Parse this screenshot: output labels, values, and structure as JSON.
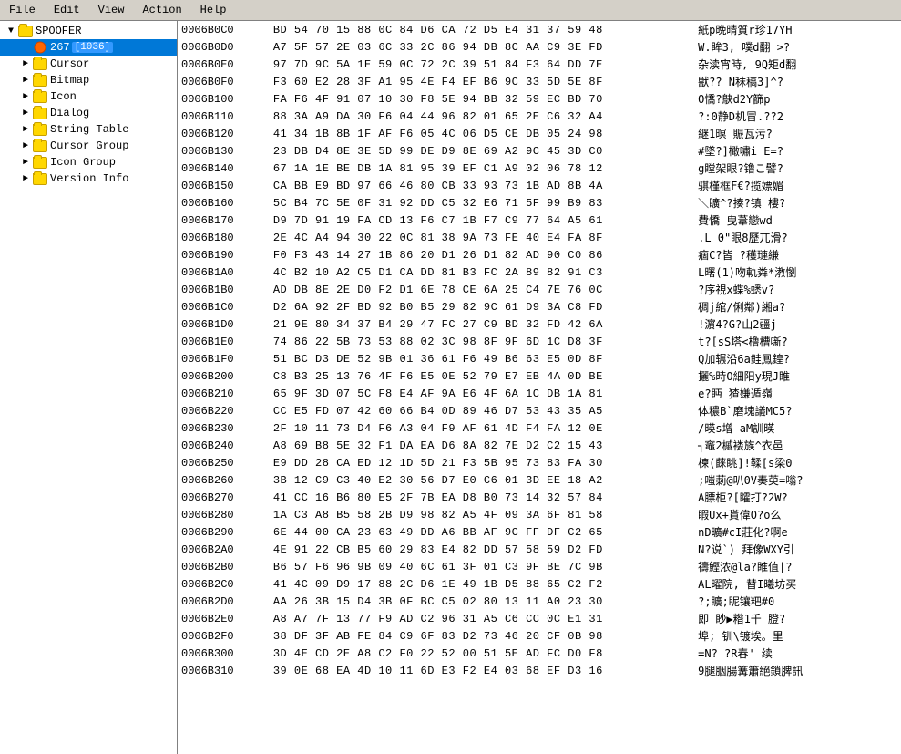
{
  "menu": {
    "items": [
      "File",
      "Edit",
      "View",
      "Action",
      "Help"
    ]
  },
  "sidebar": {
    "root": {
      "label": "SPOOFER",
      "expanded": true
    },
    "selected_item": {
      "label": "267",
      "badge": "[1036]"
    },
    "items": [
      {
        "id": "cursor",
        "label": "Cursor",
        "level": 2,
        "folder": true
      },
      {
        "id": "bitmap",
        "label": "Bitmap",
        "level": 2,
        "folder": true
      },
      {
        "id": "icon",
        "label": "Icon",
        "level": 2,
        "folder": true
      },
      {
        "id": "dialog",
        "label": "Dialog",
        "level": 2,
        "folder": true
      },
      {
        "id": "string-table",
        "label": "String Table",
        "level": 2,
        "folder": true
      },
      {
        "id": "cursor-group",
        "label": "Cursor Group",
        "level": 2,
        "folder": true
      },
      {
        "id": "icon-group",
        "label": "Icon Group",
        "level": 2,
        "folder": true
      },
      {
        "id": "version-info",
        "label": "Version Info",
        "level": 2,
        "folder": true
      }
    ]
  },
  "hex_rows": [
    {
      "addr": "0006B0C0",
      "bytes": "BD 54 70 15 88 0C 84 D6 CA 72 D5 E4 31 37 59 48",
      "ascii": "紙p晩晴質r珍17YH"
    },
    {
      "addr": "0006B0D0",
      "bytes": "A7 5F 57 2E 03 6C 33 2C 86 94 DB 8C AA C9 3E FD",
      "ascii": "W.眸3, 噗d翻 >?"
    },
    {
      "addr": "0006B0E0",
      "bytes": "97 7D 9C 5A 1E 59 0C 72 2C 39 51 84 F3 64 DD 7E",
      "ascii": "杂渎宵時, 9Q矩d翻"
    },
    {
      "addr": "0006B0F0",
      "bytes": "F3 60 E2 28 3F A1 95 4E F4 EF B6 9C 33 5D 5E 8F",
      "ascii": "獣?? N秣稿3]^?"
    },
    {
      "addr": "0006B100",
      "bytes": "FA F6 4F 91 07 10 30 F8 5E 94 BB 32 59 EC BD 70",
      "ascii": "O憍?鴃d2Y篩p"
    },
    {
      "addr": "0006B110",
      "bytes": "88 3A A9 DA 30 F6 04 44 96 82 01 65 2E C6 32 A4",
      "ascii": "?:0静D机冒.??2"
    },
    {
      "addr": "0006B120",
      "bytes": "41 34 1B 8B 1F AF F6 05 4C 06 D5 CE DB 05 24 98",
      "ascii": "継1暝  賑瓦污?"
    },
    {
      "addr": "0006B130",
      "bytes": "23 DB D4 8E 3E 5D 99 DE D9 8E 69 A2 9C 45 3D C0",
      "ascii": "#墜?]橄嘯i  E=?"
    },
    {
      "addr": "0006B140",
      "bytes": "67 1A 1E BE DB 1A 81 95 39 EF C1 A9 02 06 78 12",
      "ascii": "g瞠架眼?镥こ譬?"
    },
    {
      "addr": "0006B150",
      "bytes": "CA BB E9 BD 97 66 46 80 CB 33 93 73 1B AD 8B 4A",
      "ascii": "骐槿框F€?揽嫖媚"
    },
    {
      "addr": "0006B160",
      "bytes": "5C B4 7C 5E 0F 31 92 DD C5 32 E6 71 5F 99 B9 83",
      "ascii": "＼矌^?揍?镇 樓?"
    },
    {
      "addr": "0006B170",
      "bytes": "D9 7D 91 19 FA CD 13 F6 C7 1B F7 C9 77 64 A5 61",
      "ascii": "費憍 曳葦戀wd"
    },
    {
      "addr": "0006B180",
      "bytes": "2E 4C A4 94 30 22 0C 81 38 9A 73 FE 40 E4 FA 8F",
      "ascii": ".L 0\"眼8歷兀滑?"
    },
    {
      "addr": "0006B190",
      "bytes": "F0 F3 43 14 27 1B 86 20 D1 26 D1 82 AD 90 C0 86",
      "ascii": "痼C?皆 ?穫璉縑"
    },
    {
      "addr": "0006B1A0",
      "bytes": "4C B2 10 A2 C5 D1 CA DD 81 B3 FC 2A 89 82 91 C3",
      "ascii": "L曙(1)吻軌粦*漖懰"
    },
    {
      "addr": "0006B1B0",
      "bytes": "AD DB 8E 2E D0 F2 D1 6E 78 CE 6A 25 C4 7E 76 0C",
      "ascii": "?序視x蝶%蟋v?"
    },
    {
      "addr": "0006B1C0",
      "bytes": "D2 6A 92 2F BD 92 B0 B5 29 82 9C 61 D9 3A C8 FD",
      "ascii": "稠j綰/俐鄰)緗a?"
    },
    {
      "addr": "0006B1D0",
      "bytes": "21 9E 80 34 37 B4 29 47 FC 27 C9 BD 32 FD 42 6A",
      "ascii": "!濵4?G?山2疆j"
    },
    {
      "addr": "0006B1E0",
      "bytes": "74 86 22 5B 73 53 88 02 3C 98 8F 9F 6D 1C D8 3F",
      "ascii": "t?[sS塔<橹槽噺?"
    },
    {
      "addr": "0006B1F0",
      "bytes": "51 BC D3 DE 52 9B 01 36 61 F6 49 B6 63 E5 0D 8F",
      "ascii": "Q加辗沿6a鲑鳳鍠?"
    },
    {
      "addr": "0006B200",
      "bytes": "C8 B3 25 13 76 4F F6 E5 0E 52 79 E7 EB 4A 0D BE",
      "ascii": "攦%時O細阳y現J睢"
    },
    {
      "addr": "0006B210",
      "bytes": "65 9F 3D 07 5C F8 E4 AF 9A E6 4F 6A 1C DB 1A 81",
      "ascii": "e?眄 猹嫌遁嶺"
    },
    {
      "addr": "0006B220",
      "bytes": "CC E5 FD 07 42 60 66 B4 0D 89 46 D7 53 43 35 A5",
      "ascii": "体穠B`磨塊議MC5?"
    },
    {
      "addr": "0006B230",
      "bytes": "2F 10 11 73 D4 F6 A3 04 F9 AF 61 4D F4 FA 12 0E",
      "ascii": "/暎s增  aM訓暎"
    },
    {
      "addr": "0006B240",
      "bytes": "A8 69 B8 5E 32 F1 DA EA D6 8A 82 7E D2 C2 15 43",
      "ascii": "┐竈2槭褛族^衣邑"
    },
    {
      "addr": "0006B250",
      "bytes": "E9 DD 28 CA ED 12 1D 5D 21 F3 5B 95 73 83 FA 30",
      "ascii": "楝(蔝眺]!鞣[s梁0"
    },
    {
      "addr": "0006B260",
      "bytes": "3B 12 C9 C3 40 E2 30 56 D7 E0 C6 01 3D EE 18 A2",
      "ascii": ";嗤莿@叭0V奏萸=嗡?"
    },
    {
      "addr": "0006B270",
      "bytes": "41 CC 16 B6 80 E5 2F 7B EA D8 B0 73 14 32 57 84",
      "ascii": "A膘柜?[矐打?2W?"
    },
    {
      "addr": "0006B280",
      "bytes": "1A C3 A8 B5 58 2B D9 98 82 A5 4F 09 3A 6F 81 58",
      "ascii": "睱Ux+貰偉O?o么"
    },
    {
      "addr": "0006B290",
      "bytes": "6E 44 00 CA 23 63 49 DD A6 BB AF 9C FF DF C2 65",
      "ascii": "nD曠#cI莊化?啊e"
    },
    {
      "addr": "0006B2A0",
      "bytes": "4E 91 22 CB B5 60 29 83 E4 82 DD 57 58 59 D2 FD",
      "ascii": "N?说`) 拜像WXY引"
    },
    {
      "addr": "0006B2B0",
      "bytes": "B6 57 F6 96 9B 09 40 6C 61 3F 01 C3 9F BE 7C 9B",
      "ascii": "禱鰹浓@la?睢值|?"
    },
    {
      "addr": "0006B2C0",
      "bytes": "41 4C 09 D9 17 88 2C D6 1E 49 1B D5 88 65 C2 F2",
      "ascii": "AL曜院, 替I曦坊买"
    },
    {
      "addr": "0006B2D0",
      "bytes": "AA 26 3B 15 D4 3B 0F BC C5 02 80 13 11 A0 23 30",
      "ascii": "?;矌;眤镶粑#0"
    },
    {
      "addr": "0006B2E0",
      "bytes": "A8 A7 7F 13 77 F9 AD C2 96 31 A5 C6 CC 0C E1 31",
      "ascii": "即 眇▶糌1千 膯?"
    },
    {
      "addr": "0006B2F0",
      "bytes": "38 DF 3F AB FE 84 C9 6F 83 D2 73 46 20 CF 0B 98",
      "ascii": "埠; 钏\\镀埃。里"
    },
    {
      "addr": "0006B300",
      "bytes": "3D 4E CD 2E A8 C2 F0 22 52 00 51 5E AD FC D0 F8",
      "ascii": "=N? ?R春' 续"
    },
    {
      "addr": "0006B310",
      "bytes": "39 0E 68 EA 4D 10 11 6D E3 F2 E4 03 68 EF D3 16",
      "ascii": "9腿胭腸篝簫絕鎖脾訊"
    }
  ],
  "colors": {
    "address": "#0000cc",
    "header_bg": "#000080",
    "header_text": "#ffffff",
    "selected_bg": "#0078d7",
    "folder_color": "#ffd700",
    "badge_bg": "#3399ff"
  }
}
